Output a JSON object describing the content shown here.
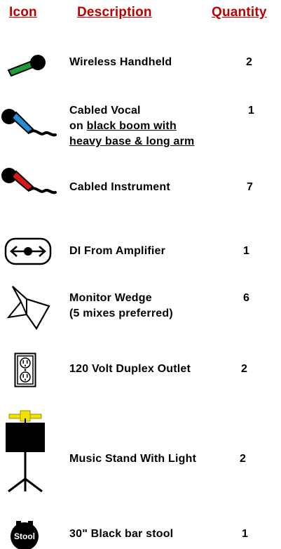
{
  "headers": {
    "icon": "Icon",
    "description": "Description",
    "quantity": "Quantity"
  },
  "rows": [
    {
      "icon": "wireless-mic-icon",
      "description": [
        "Wireless Handheld"
      ],
      "quantity": "2"
    },
    {
      "icon": "cabled-vocal-mic-icon",
      "description": [
        "Cabled Vocal",
        "on ",
        "black boom with",
        "heavy base & long arm"
      ],
      "quantity": "1"
    },
    {
      "icon": "cabled-instrument-mic-icon",
      "description": [
        "Cabled Instrument"
      ],
      "quantity": "7"
    },
    {
      "icon": "di-box-icon",
      "description": [
        "DI From Amplifier"
      ],
      "quantity": "1"
    },
    {
      "icon": "monitor-wedge-icon",
      "description": [
        "Monitor Wedge",
        "(5 mixes preferred)"
      ],
      "quantity": "6"
    },
    {
      "icon": "duplex-outlet-icon",
      "description": [
        "120 Volt Duplex Outlet"
      ],
      "quantity": "2"
    },
    {
      "icon": "music-stand-light-icon",
      "description": [
        "Music Stand With Light"
      ],
      "quantity": "2"
    },
    {
      "icon": "bar-stool-icon",
      "icon_label": "Stool",
      "description": [
        "30\" Black bar stool"
      ],
      "quantity": "1"
    }
  ],
  "colors": {
    "header": "#c00000",
    "wireless_mic": "#1e9c3c",
    "vocal_mic": "#1f8fd8",
    "instrument_mic": "#d81818",
    "stand_light": "#f2e200"
  }
}
